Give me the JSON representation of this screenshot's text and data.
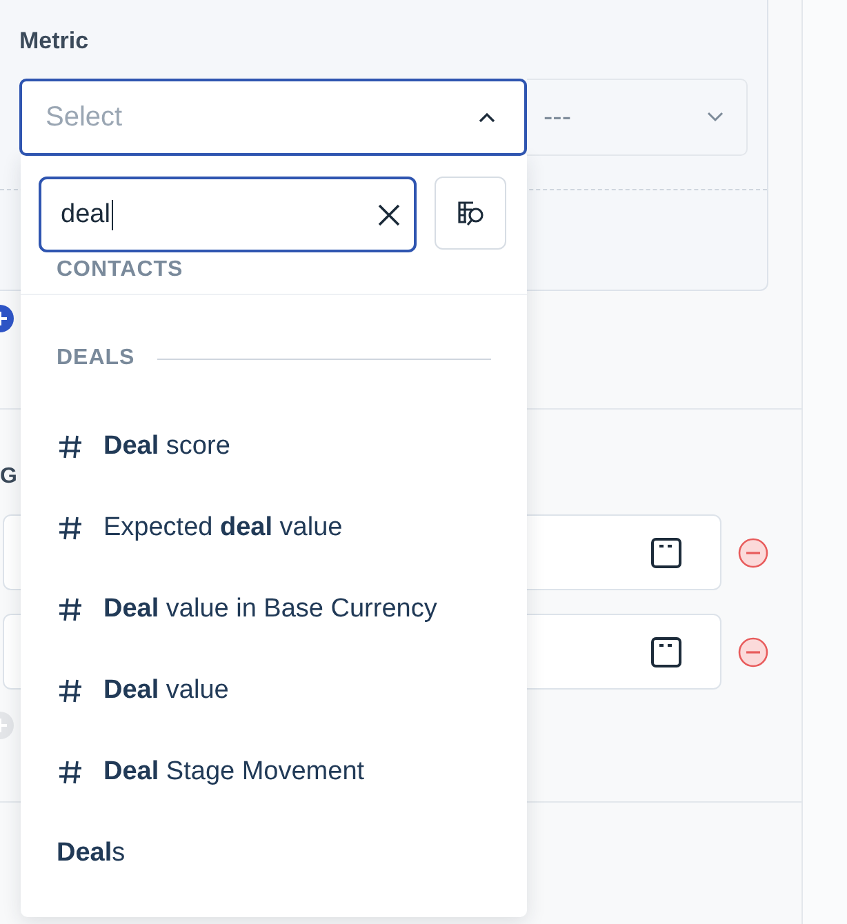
{
  "metric": {
    "label": "Metric",
    "select": {
      "placeholder": "Select",
      "expanded": true
    },
    "secondary_select": {
      "value": "---"
    }
  },
  "section_label": "G",
  "date_rows": [
    {
      "kind": "date"
    },
    {
      "kind": "date"
    }
  ],
  "add_buttons": [
    {
      "disabled": false
    },
    {
      "disabled": true
    }
  ],
  "dropdown": {
    "search": {
      "value": "deal"
    },
    "groups": [
      {
        "heading": "CONTACTS"
      },
      {
        "heading": "DEALS",
        "items": [
          {
            "kind": "field",
            "label": "**Deal** score"
          },
          {
            "kind": "field",
            "label": "Expected **deal** value"
          },
          {
            "kind": "field",
            "label": "**Deal** value in Base Currency"
          },
          {
            "kind": "field",
            "label": "**Deal** value"
          },
          {
            "kind": "field",
            "label": "**Deal** Stage Movement"
          },
          {
            "kind": "entity",
            "label": "**Deal**s"
          }
        ]
      }
    ]
  }
}
